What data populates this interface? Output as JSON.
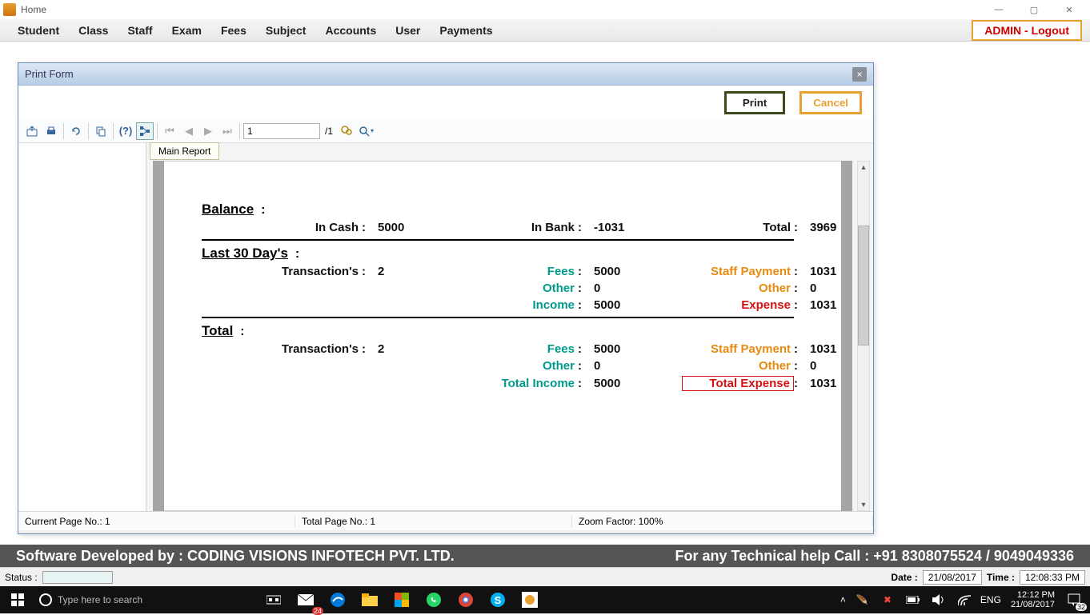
{
  "window": {
    "title": "Home"
  },
  "window_controls": {
    "min": "—",
    "max": "▢",
    "close": "✕"
  },
  "menu": {
    "items": [
      "Student",
      "Class",
      "Staff",
      "Exam",
      "Fees",
      "Subject",
      "Accounts",
      "User",
      "Payments"
    ],
    "admin": "ADMIN - Logout"
  },
  "dialog": {
    "title": "Print Form",
    "print": "Print",
    "cancel": "Cancel",
    "close_x": "×",
    "toolbar": {
      "page_value": "1",
      "page_total": "/1"
    },
    "tab": "Main Report",
    "status": {
      "current": "Current Page No.: 1",
      "total": "Total Page No.: 1",
      "zoom": "Zoom Factor: 100%"
    }
  },
  "report": {
    "balance": {
      "title": "Balance",
      "in_cash_label": "In Cash",
      "in_cash": "5000",
      "in_bank_label": "In Bank",
      "in_bank": "-1031",
      "total_label": "Total",
      "total": "3969"
    },
    "last30": {
      "title": "Last 30 Day's",
      "trans_label": "Transaction's",
      "trans": "2",
      "fees_label": "Fees",
      "fees": "5000",
      "staff_label": "Staff Payment",
      "staff": "1031",
      "other_inc_label": "Other",
      "other_inc": "0",
      "other_exp_label": "Other",
      "other_exp": "0",
      "income_label": "Income",
      "income": "5000",
      "expense_label": "Expense",
      "expense": "1031"
    },
    "total": {
      "title": "Total",
      "trans_label": "Transaction's",
      "trans": "2",
      "fees_label": "Fees",
      "fees": "5000",
      "staff_label": "Staff Payment",
      "staff": "1031",
      "other_inc_label": "Other",
      "other_inc": "0",
      "other_exp_label": "Other",
      "other_exp": "0",
      "total_income_label": "Total Income",
      "total_income": "5000",
      "total_expense_label": "Total Expense",
      "total_expense": "1031"
    }
  },
  "banner": {
    "left": "Software Developed by : CODING VISIONS INFOTECH PVT. LTD.",
    "right": "For any Technical help Call : +91 8308075524 / 9049049336"
  },
  "winstatus": {
    "status_label": "Status :",
    "date_label": "Date :",
    "date": "21/08/2017",
    "time_label": "Time :",
    "time": "12:08:33 PM"
  },
  "taskbar": {
    "search_placeholder": "Type here to search",
    "mail_badge": "24",
    "lang": "ENG",
    "clock_time": "12:12 PM",
    "clock_date": "21/08/2017",
    "notif_badge": "32"
  }
}
